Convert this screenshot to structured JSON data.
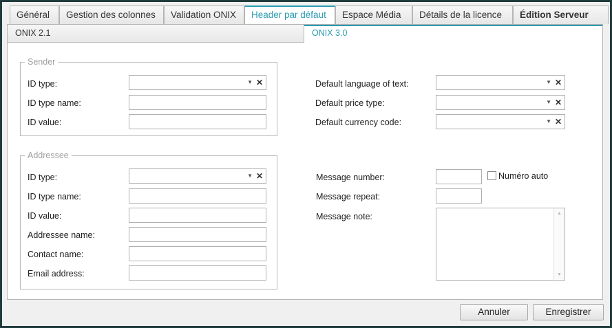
{
  "tabs": [
    {
      "label": "Général"
    },
    {
      "label": "Gestion des colonnes"
    },
    {
      "label": "Validation ONIX"
    },
    {
      "label": "Header par défaut"
    },
    {
      "label": "Espace Média"
    },
    {
      "label": "Détails de la licence"
    },
    {
      "label": "Édition Serveur"
    }
  ],
  "active_tab": "Header par défaut",
  "subtabs": [
    {
      "label": "ONIX 2.1"
    },
    {
      "label": "ONIX 3.0"
    }
  ],
  "active_subtab": "ONIX 3.0",
  "sender": {
    "legend": "Sender",
    "id_type_label": "ID type:",
    "id_type_name_label": "ID type name:",
    "id_value_label": "ID value:",
    "id_type_value": "",
    "id_type_name_value": "",
    "id_value_value": ""
  },
  "defaults": {
    "language_label": "Default language of text:",
    "price_type_label": "Default price type:",
    "currency_label": "Default currency code:",
    "language_value": "",
    "price_type_value": "",
    "currency_value": ""
  },
  "addressee": {
    "legend": "Addressee",
    "id_type_label": "ID type:",
    "id_type_name_label": "ID type name:",
    "id_value_label": "ID value:",
    "addressee_name_label": "Addressee name:",
    "contact_name_label": "Contact name:",
    "email_label": "Email address:"
  },
  "message": {
    "number_label": "Message number:",
    "auto_number_label": "Numéro auto",
    "auto_number_checked": false,
    "repeat_label": "Message repeat:",
    "note_label": "Message note:"
  },
  "buttons": {
    "cancel": "Annuler",
    "save": "Enregistrer"
  },
  "icons": {
    "dropdown": "chevron-down-icon",
    "clear": "close-icon",
    "scroll_up": "scroll-up-icon",
    "scroll_down": "scroll-down-icon"
  },
  "colors": {
    "accent": "#2a9bb0",
    "frame": "#1f3b3b"
  }
}
